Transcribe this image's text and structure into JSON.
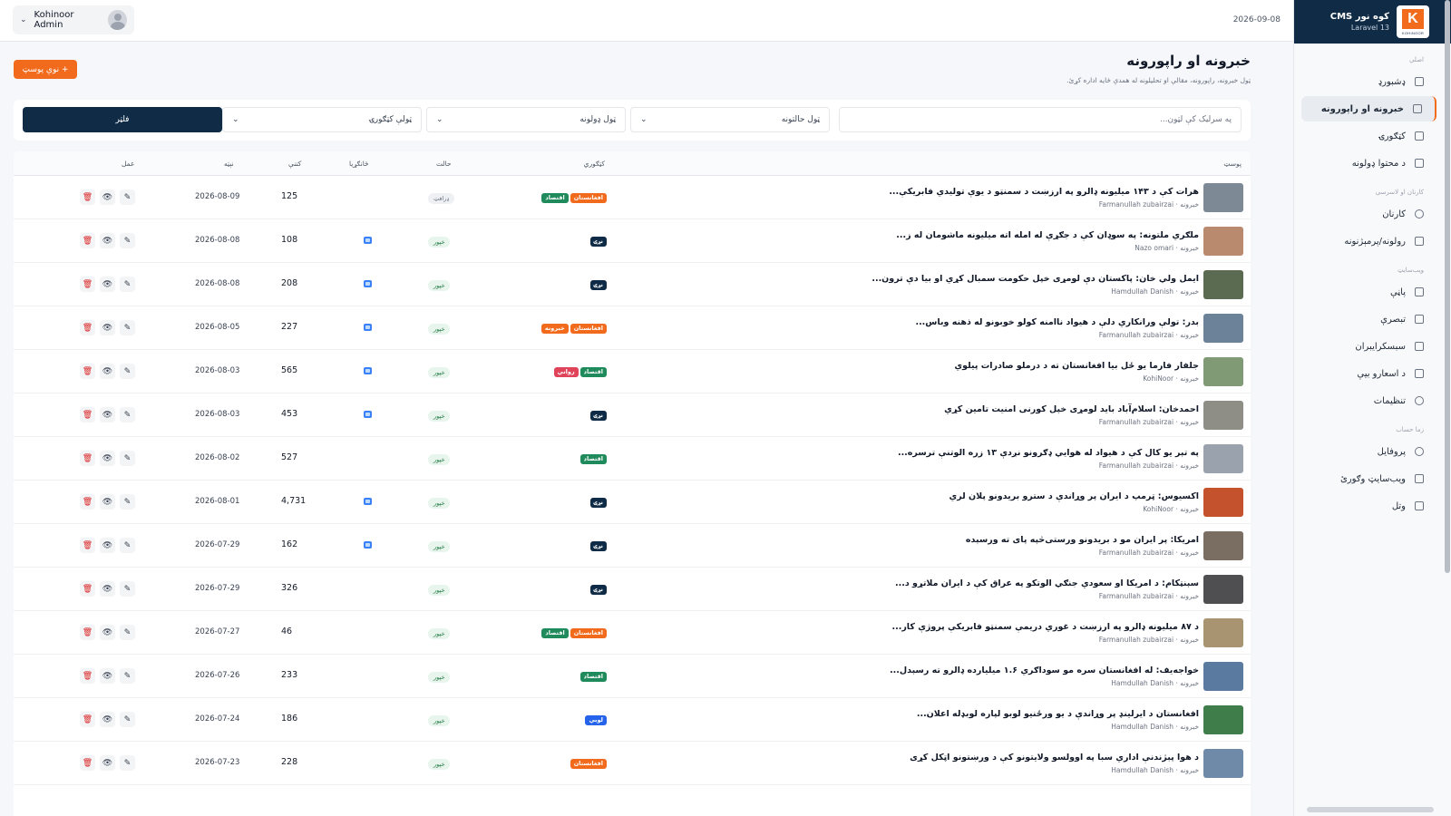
{
  "colors": {
    "brand_orange": "#f26b1d",
    "navy": "#0f2b46",
    "economy": "#1f8a5b",
    "afghanistan": "#f26b1d",
    "world": "#0f2b46",
    "news": "#f26b1d",
    "psychology": "#e0445b",
    "local": "#2563eb"
  },
  "brand": {
    "title": "کوه نور CMS",
    "sub": "Laravel 13",
    "logo_letter": "K",
    "logo_word": "KOHINOOR"
  },
  "sidebar": {
    "sections": [
      {
        "title": "اصلي",
        "items": [
          {
            "label": "ډشبورډ",
            "icon": "grid-icon"
          },
          {
            "label": "خبرونه او راپورونه",
            "icon": "newspaper-icon",
            "active": true
          },
          {
            "label": "کټګورۍ",
            "icon": "tag-icon"
          },
          {
            "label": "د محتوا ډولونه",
            "icon": "folder-icon"
          }
        ]
      },
      {
        "title": "کارنان او لاسرسی",
        "items": [
          {
            "label": "کارنان",
            "icon": "users-icon"
          },
          {
            "label": "رولونه/پرمېژنونه",
            "icon": "shield-icon"
          }
        ]
      },
      {
        "title": "ویب‌سایټ",
        "items": [
          {
            "label": "پاڼې",
            "icon": "page-icon"
          },
          {
            "label": "تبصرې",
            "icon": "comment-icon"
          },
          {
            "label": "سبسکرایبران",
            "icon": "mail-icon"
          },
          {
            "label": "د اسعارو بیې",
            "icon": "coins-icon"
          },
          {
            "label": "تنظیمات",
            "icon": "gear-icon"
          }
        ]
      },
      {
        "title": "زما حساب",
        "items": [
          {
            "label": "پروفایل",
            "icon": "user-circle-icon"
          },
          {
            "label": "ویب‌سایټ وګورئ",
            "icon": "external-link-icon"
          },
          {
            "label": "وتل",
            "icon": "logout-icon"
          }
        ]
      }
    ]
  },
  "topbar": {
    "user": "Kohinoor Admin",
    "date": "2026-09-08"
  },
  "page": {
    "title": "خبرونه او راپورونه",
    "subtitle": "ټول خبرونه، راپورونه، مقالې او تحلیلونه له همدې ځایه اداره کړئ.",
    "new_button": "+ نوې پوسټ"
  },
  "filters": {
    "search_placeholder": "په سرلیک کې لټون...",
    "status": "ټول حالتونه",
    "types": "ټول ډولونه",
    "categories": "ټولې کټګورۍ",
    "button": "فلټر"
  },
  "table": {
    "headers": {
      "post": "پوسټ",
      "category": "کټګوري",
      "status": "حالت",
      "featured": "ځانګړیا",
      "views": "کتنې",
      "date": "نېټه",
      "action": "عمل"
    },
    "rows": [
      {
        "title": "هرات کې د ۱۴۳ میلیونه ډالرو په ارزښت د سمنټو د یوې تولیدي فابریکې...",
        "type": "خبرونه",
        "author": "Farmanullah zubairzai",
        "cats": [
          [
            "افغانستان",
            "#f26b1d"
          ],
          [
            "اقتصاد",
            "#1f8a5b"
          ]
        ],
        "status": "ډرافټ",
        "draft": true,
        "featured": false,
        "views": "125",
        "date": "2026-08-09",
        "thumb": "#7d8a96"
      },
      {
        "title": "ملګري ملتونه: په سوډان کې د جګړې له امله اته میلیونه ماشومان له ز...",
        "type": "خبرونه",
        "author": "Nazo omari",
        "cats": [
          [
            "نړۍ",
            "#0f2b46"
          ]
        ],
        "status": "خپور",
        "draft": false,
        "featured": true,
        "views": "108",
        "date": "2026-08-08",
        "thumb": "#b98a6e"
      },
      {
        "title": "ایمل ولي خان: پاکستان دې لومړی خپل حکومت سمبال کړي او بیا دې ترون...",
        "type": "خبرونه",
        "author": "Hamdullah Danish",
        "cats": [
          [
            "نړۍ",
            "#0f2b46"
          ]
        ],
        "status": "خپور",
        "draft": false,
        "featured": true,
        "views": "208",
        "date": "2026-08-08",
        "thumb": "#5a6b52"
      },
      {
        "title": "بدر: تولې ورانکاري دلې د هیواد ناامنه کولو خوبونو له ذهنه وباس...",
        "type": "خبرونه",
        "author": "Farmanullah zubairzai",
        "cats": [
          [
            "افغانستان",
            "#f26b1d"
          ],
          [
            "خبرونه",
            "#f26b1d"
          ]
        ],
        "status": "خپور",
        "draft": false,
        "featured": true,
        "views": "227",
        "date": "2026-08-05",
        "thumb": "#6b8299"
      },
      {
        "title": "جلفار فارما یو ځل بیا افغانستان ته د درملو صادرات پیلوي",
        "type": "خبرونه",
        "author": "KohiNoor",
        "cats": [
          [
            "اقتصاد",
            "#1f8a5b"
          ],
          [
            "رواني",
            "#e0445b"
          ]
        ],
        "status": "خپور",
        "draft": false,
        "featured": true,
        "views": "565",
        "date": "2026-08-03",
        "thumb": "#7f9a74"
      },
      {
        "title": "احمدخان: اسلام‌آباد باید لومړی خپل کورنی امنیت تامین کړي",
        "type": "خبرونه",
        "author": "Farmanullah zubairzai",
        "cats": [
          [
            "نړۍ",
            "#0f2b46"
          ]
        ],
        "status": "خپور",
        "draft": false,
        "featured": true,
        "views": "453",
        "date": "2026-08-03",
        "thumb": "#8e8d86"
      },
      {
        "title": "په تېر یو کال کې د هیواد له هوایي ډګرونو نږدې ۱۳ زره الوتنې ترسره...",
        "type": "خبرونه",
        "author": "Farmanullah zubairzai",
        "cats": [
          [
            "اقتصاد",
            "#1f8a5b"
          ]
        ],
        "status": "خپور",
        "draft": false,
        "featured": false,
        "views": "527",
        "date": "2026-08-02",
        "thumb": "#9aa3ad"
      },
      {
        "title": "اکسیوس: ټرمپ د ایران پر وړاندې د سترو بریدونو پلان لري",
        "type": "خبرونه",
        "author": "KohiNoor",
        "cats": [
          [
            "نړۍ",
            "#0f2b46"
          ]
        ],
        "status": "خپور",
        "draft": false,
        "featured": true,
        "views": "4,731",
        "date": "2026-08-01",
        "thumb": "#c3522d"
      },
      {
        "title": "امریکا: پر ایران مو د بریدونو ورستی‌څپه پای ته ورسېده",
        "type": "خبرونه",
        "author": "Farmanullah zubairzai",
        "cats": [
          [
            "نړۍ",
            "#0f2b46"
          ]
        ],
        "status": "خپور",
        "draft": false,
        "featured": true,
        "views": "162",
        "date": "2026-07-29",
        "thumb": "#7a6e63"
      },
      {
        "title": "سېنټکام: د امریکا او سعودي جنګي الوتکو په عراق کې د ایران ملاتړو د...",
        "type": "خبرونه",
        "author": "Farmanullah zubairzai",
        "cats": [
          [
            "نړۍ",
            "#0f2b46"
          ]
        ],
        "status": "خپور",
        "draft": false,
        "featured": false,
        "views": "326",
        "date": "2026-07-29",
        "thumb": "#4f4f52"
      },
      {
        "title": "د ۸۷ میلیونه ډالرو په ارزښت د غوري دریمې سمنټو فابریکې پروژې کار...",
        "type": "خبرونه",
        "author": "Farmanullah zubairzai",
        "cats": [
          [
            "افغانستان",
            "#f26b1d"
          ],
          [
            "اقتصاد",
            "#1f8a5b"
          ]
        ],
        "status": "خپور",
        "draft": false,
        "featured": false,
        "views": "46",
        "date": "2026-07-27",
        "thumb": "#a89470"
      },
      {
        "title": "خواجه‌یف: له افغانستان سره مو سوداګري ۱.۶ میلیارده ډالرو ته رسېدل...",
        "type": "خبرونه",
        "author": "Hamdullah Danish",
        "cats": [
          [
            "اقتصاد",
            "#1f8a5b"
          ]
        ],
        "status": "خپور",
        "draft": false,
        "featured": false,
        "views": "233",
        "date": "2026-07-26",
        "thumb": "#5b7aa0"
      },
      {
        "title": "افغانستان د ایرلینډ پر وړاندې د یو ورځنیو لوبو لپاره لوبډله اعلان...",
        "type": "خبرونه",
        "author": "Hamdullah Danish",
        "cats": [
          [
            "لوبې",
            "#2563eb"
          ]
        ],
        "status": "خپور",
        "draft": false,
        "featured": false,
        "views": "186",
        "date": "2026-07-24",
        "thumb": "#3f7d4a"
      },
      {
        "title": "د هوا پېژندنې اداري سبا په اوولسو ولایتونو کې د ورښتونو اټکل کړی",
        "type": "خبرونه",
        "author": "Hamdullah Danish",
        "cats": [
          [
            "افغانستان",
            "#f26b1d"
          ]
        ],
        "status": "خپور",
        "draft": false,
        "featured": false,
        "views": "228",
        "date": "2026-07-23",
        "thumb": "#6f8aa8"
      }
    ]
  }
}
